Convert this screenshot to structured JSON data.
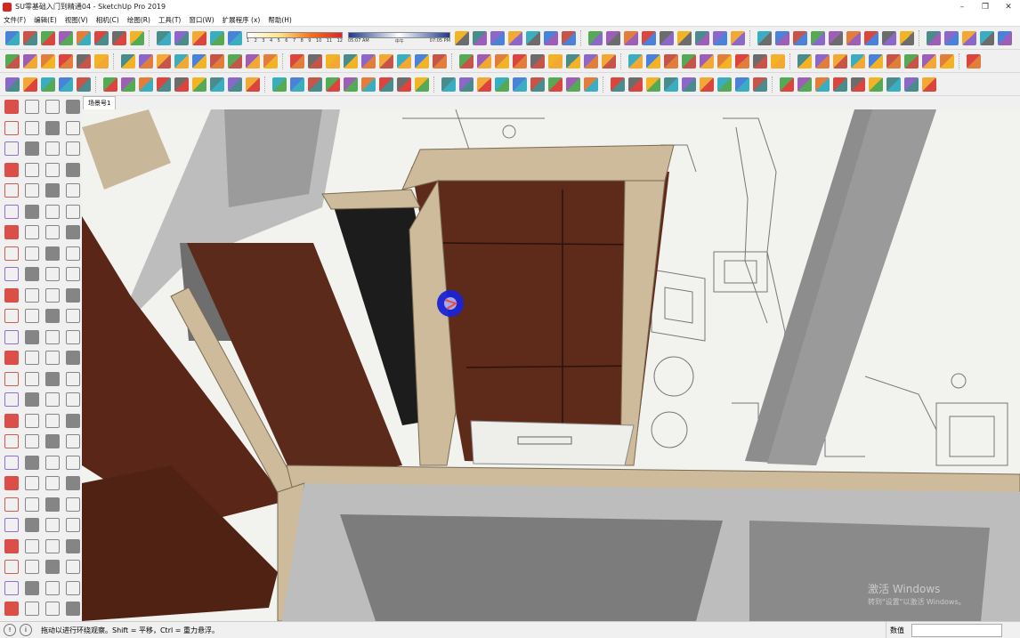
{
  "window": {
    "title": "SU零基础入门到精通04 - SketchUp Pro 2019",
    "minimize": "–",
    "maximize": "❐",
    "close": "✕"
  },
  "menu": [
    "文件(F)",
    "编辑(E)",
    "视图(V)",
    "相机(C)",
    "绘图(R)",
    "工具(T)",
    "窗口(W)",
    "扩展程序 (x)",
    "帮助(H)"
  ],
  "shadow": {
    "months": [
      "1",
      "2",
      "3",
      "4",
      "5",
      "6",
      "7",
      "8",
      "9",
      "10",
      "11",
      "12"
    ],
    "time_start": "05:07 AM",
    "time_mid": "中午",
    "time_end": "07:05 PM"
  },
  "scene_tab": "场景号1",
  "status": {
    "message": "拖动以进行环绕观察。Shift = 平移，Ctrl = 重力悬浮。",
    "measurements_label": "数值"
  },
  "watermark": {
    "line1": "激活 Windows",
    "line2": "转到\"设置\"以激活 Windows。"
  },
  "colors": {
    "cabinet_wood": "#5a2618",
    "frame_beige": "#cdbb9b",
    "wall": "#c8c8c8",
    "floor": "#f2f2ef",
    "orbit_blue": "#1a23d6",
    "app_red": "#d8261f"
  }
}
